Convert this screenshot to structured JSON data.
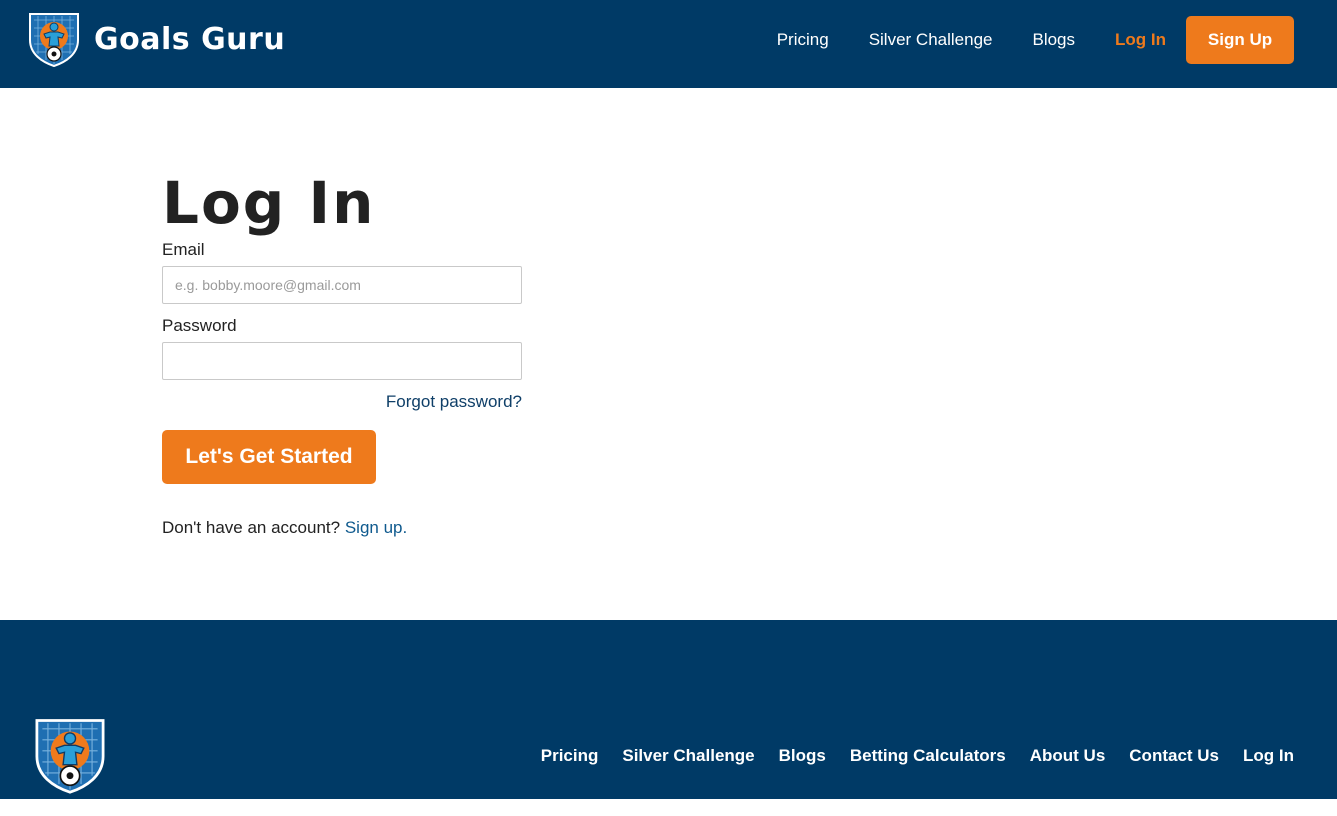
{
  "brand": {
    "name": "Goals Guru",
    "logo": "shield-goalkeeper-logo-icon"
  },
  "header_nav": {
    "items": [
      "Pricing",
      "Silver Challenge",
      "Blogs"
    ],
    "login": "Log In",
    "signup": "Sign Up"
  },
  "login_form": {
    "title": "Log In",
    "email_label": "Email",
    "email_placeholder": "e.g. bobby.moore@gmail.com",
    "email_value": "",
    "password_label": "Password",
    "password_value": "",
    "forgot_password": "Forgot password?",
    "submit": "Let's Get Started",
    "no_account_text": "Don't have an account?",
    "signup_link": "Sign up."
  },
  "footer_nav": {
    "items": [
      "Pricing",
      "Silver Challenge",
      "Blogs",
      "Betting Calculators",
      "About Us",
      "Contact Us",
      "Log In"
    ]
  },
  "colors": {
    "navy": "#003a66",
    "accent_orange": "#ee7a1c",
    "link_blue": "#0f3f68"
  }
}
